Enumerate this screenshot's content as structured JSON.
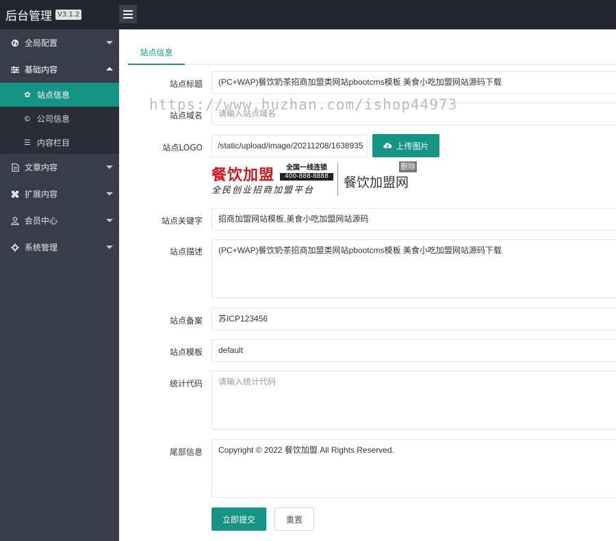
{
  "header": {
    "title": "后台管理",
    "version": "V3.1.2",
    "menu_toggle_icon": "hamburger-icon"
  },
  "sidebar": {
    "items": [
      {
        "label": "全局配置",
        "icon": "globe-icon",
        "expanded": false
      },
      {
        "label": "基础内容",
        "icon": "sliders-icon",
        "expanded": true
      },
      {
        "label": "文章内容",
        "icon": "document-icon",
        "expanded": false
      },
      {
        "label": "扩展内容",
        "icon": "puzzle-icon",
        "expanded": false
      },
      {
        "label": "会员中心",
        "icon": "user-icon",
        "expanded": false
      },
      {
        "label": "系统管理",
        "icon": "gear-icon",
        "expanded": false
      }
    ],
    "sub_items": [
      {
        "label": "站点信息",
        "icon": "gear-icon",
        "active": true
      },
      {
        "label": "公司信息",
        "icon": "copyright-icon",
        "active": false
      },
      {
        "label": "内容栏目",
        "icon": "list-icon",
        "active": false
      }
    ]
  },
  "tabs": [
    {
      "label": "站点信息",
      "active": true
    }
  ],
  "form": {
    "title_label": "站点标题",
    "title_value": "(PC+WAP)餐饮奶茶招商加盟类网站pbootcms模板 美食小吃加盟网站源码下载",
    "domain_label": "站点域名",
    "domain_placeholder": "请输入站点域名",
    "logo_label": "站点LOGO",
    "logo_value": "/static/upload/image/20211208/1638935",
    "upload_label": "上传图片",
    "delete_label": "删除",
    "keywords_label": "站点关键字",
    "keywords_value": "招商加盟网站模板,美食小吃加盟网站源码",
    "description_label": "站点描述",
    "description_value": "(PC+WAP)餐饮奶茶招商加盟类网站pbootcms模板 美食小吃加盟网站源码下载",
    "icp_label": "站点备案",
    "icp_value": "苏ICP123456",
    "template_label": "站点模板",
    "template_value": "default",
    "stats_label": "统计代码",
    "stats_placeholder": "请输入统计代码",
    "footer_label": "尾部信息",
    "footer_value": "Copyright © 2022 餐饮加盟 All Rights Reserved.",
    "submit_label": "立即提交",
    "reset_label": "重置"
  },
  "logo_preview": {
    "brand": "餐饮加盟",
    "badge_line1": "全国一线连锁",
    "badge_line2": "400-888-8888",
    "slogan": "全民创业招商加盟平台",
    "right_text": "餐饮加盟网"
  },
  "watermark": "https://www.huzhan.com/ishop44973",
  "colors": {
    "accent": "#159486",
    "sidebar_bg": "#393d49",
    "topbar_bg": "#23262e",
    "logo_red": "#d0161e"
  }
}
